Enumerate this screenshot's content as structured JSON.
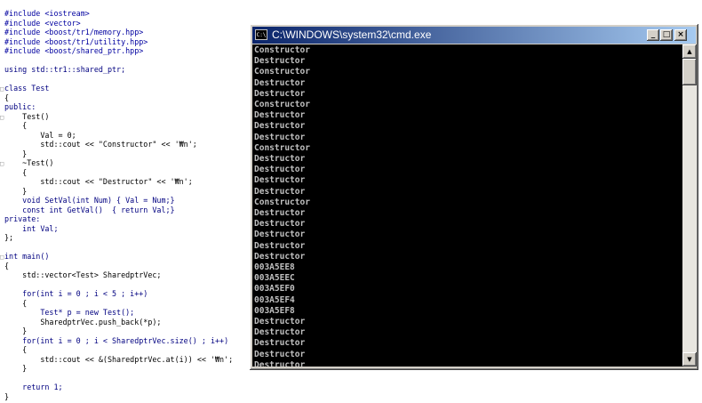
{
  "editor": {
    "lines": [
      {
        "kind": "pp",
        "fold": "",
        "text": "#include <iostream>"
      },
      {
        "kind": "pp",
        "fold": "",
        "text": "#include <vector>"
      },
      {
        "kind": "pp",
        "fold": "",
        "text": "#include <boost/tr1/memory.hpp>"
      },
      {
        "kind": "pp",
        "fold": "",
        "text": "#include <boost/tr1/utility.hpp>"
      },
      {
        "kind": "pp",
        "fold": "",
        "text": "#include <boost/shared_ptr.hpp>"
      },
      {
        "kind": "plain",
        "fold": "",
        "text": ""
      },
      {
        "kind": "kw",
        "fold": "",
        "text": "using std::tr1::shared_ptr;"
      },
      {
        "kind": "plain",
        "fold": "",
        "text": ""
      },
      {
        "kind": "kw",
        "fold": "□",
        "text": "class Test"
      },
      {
        "kind": "plain",
        "fold": "",
        "text": "{"
      },
      {
        "kind": "kw",
        "fold": "",
        "text": "public:"
      },
      {
        "kind": "plain",
        "fold": "□",
        "text": "    Test()"
      },
      {
        "kind": "plain",
        "fold": "",
        "text": "    {"
      },
      {
        "kind": "plain",
        "fold": "",
        "text": "        Val = 0;"
      },
      {
        "kind": "str",
        "fold": "",
        "text": "        std::cout << \"Constructor\" << '₩n';"
      },
      {
        "kind": "plain",
        "fold": "",
        "text": "    }"
      },
      {
        "kind": "plain",
        "fold": "□",
        "text": "    ~Test()"
      },
      {
        "kind": "plain",
        "fold": "",
        "text": "    {"
      },
      {
        "kind": "str",
        "fold": "",
        "text": "        std::cout << \"Destructor\" << '₩n';"
      },
      {
        "kind": "plain",
        "fold": "",
        "text": "    }"
      },
      {
        "kind": "kw",
        "fold": "",
        "text": "    void SetVal(int Num) { Val = Num;}"
      },
      {
        "kind": "kw",
        "fold": "",
        "text": "    const int GetVal()  { return Val;}"
      },
      {
        "kind": "kw",
        "fold": "",
        "text": "private:"
      },
      {
        "kind": "kw",
        "fold": "",
        "text": "    int Val;"
      },
      {
        "kind": "plain",
        "fold": "",
        "text": "};"
      },
      {
        "kind": "plain",
        "fold": "",
        "text": ""
      },
      {
        "kind": "kw",
        "fold": "□",
        "text": "int main()"
      },
      {
        "kind": "plain",
        "fold": "",
        "text": "{"
      },
      {
        "kind": "plain",
        "fold": "",
        "text": "    std::vector<Test> SharedptrVec;"
      },
      {
        "kind": "plain",
        "fold": "",
        "text": ""
      },
      {
        "kind": "kw",
        "fold": "",
        "text": "    for(int i = 0 ; i < 5 ; i++)"
      },
      {
        "kind": "plain",
        "fold": "",
        "text": "    {"
      },
      {
        "kind": "kw",
        "fold": "",
        "text": "        Test* p = new Test();"
      },
      {
        "kind": "plain",
        "fold": "",
        "text": "        SharedptrVec.push_back(*p);"
      },
      {
        "kind": "plain",
        "fold": "",
        "text": "    }"
      },
      {
        "kind": "kw",
        "fold": "",
        "text": "    for(int i = 0 ; i < SharedptrVec.size() ; i++)"
      },
      {
        "kind": "plain",
        "fold": "",
        "text": "    {"
      },
      {
        "kind": "str",
        "fold": "",
        "text": "        std::cout << &(SharedptrVec.at(i)) << '₩n';"
      },
      {
        "kind": "plain",
        "fold": "",
        "text": "    }"
      },
      {
        "kind": "plain",
        "fold": "",
        "text": ""
      },
      {
        "kind": "kw",
        "fold": "",
        "text": "    return 1;"
      },
      {
        "kind": "plain",
        "fold": "",
        "text": "}"
      }
    ]
  },
  "console": {
    "title": "C:\\WINDOWS\\system32\\cmd.exe",
    "icon_label": "C:\\",
    "buttons": {
      "minimize": "_",
      "maximize": "□",
      "close": "×"
    },
    "scroll": {
      "up": "▲",
      "down": "▼"
    },
    "output": [
      "Constructor",
      "Destructor",
      "Constructor",
      "Destructor",
      "Destructor",
      "Constructor",
      "Destructor",
      "Destructor",
      "Destructor",
      "Constructor",
      "Destructor",
      "Destructor",
      "Destructor",
      "Destructor",
      "Constructor",
      "Destructor",
      "Destructor",
      "Destructor",
      "Destructor",
      "Destructor",
      "003A5EE8",
      "003A5EEC",
      "003A5EF0",
      "003A5EF4",
      "003A5EF8",
      "Destructor",
      "Destructor",
      "Destructor",
      "Destructor",
      "Destructor"
    ]
  },
  "colors": {
    "title_gradient_start": "#0a246a",
    "title_gradient_end": "#a6caf0",
    "console_bg": "#000000",
    "console_text": "#c0c0c0",
    "window_face": "#d4d0c8"
  }
}
